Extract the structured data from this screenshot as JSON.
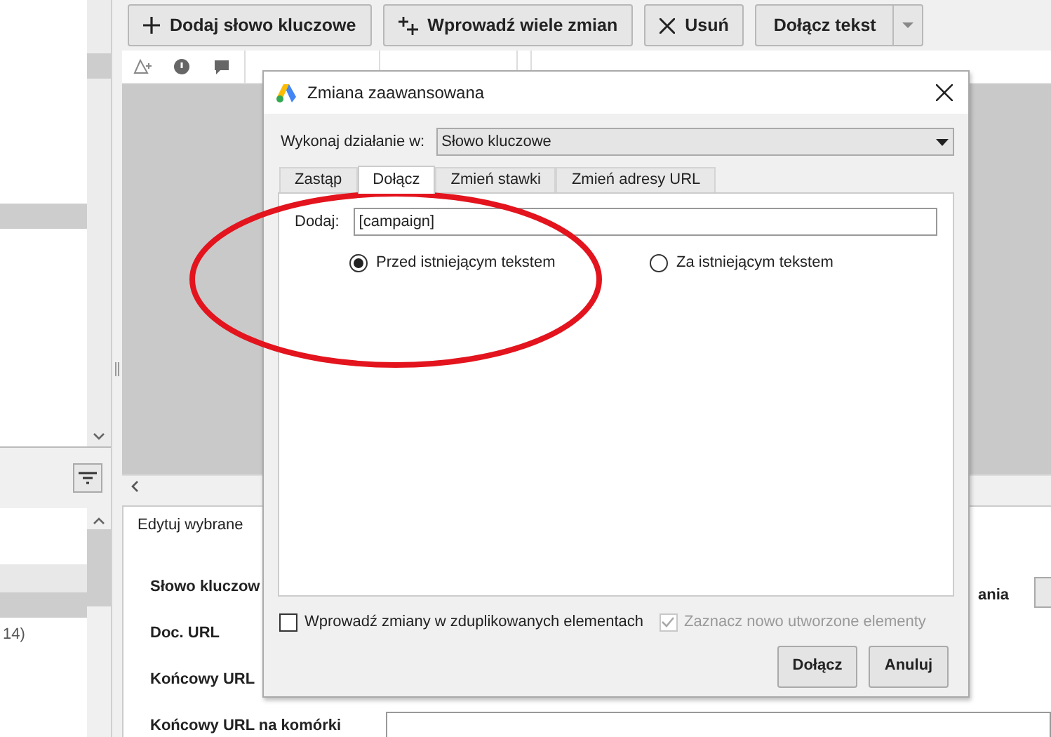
{
  "toolbar": {
    "buttons": [
      {
        "label": "Dodaj słowo kluczowe",
        "kind": "plus"
      },
      {
        "label": "Wprowadź wiele zmian",
        "kind": "multi"
      },
      {
        "label": "Usuń",
        "kind": "remove"
      },
      {
        "label": "Dołącz tekst",
        "kind": "split"
      }
    ]
  },
  "sidebar": {
    "items": [
      {
        "selected": false
      },
      {
        "selected": true
      }
    ],
    "counts": [
      "14)"
    ]
  },
  "edit_panel": {
    "tab": "Edytuj wybrane",
    "fields": [
      "Słowo kluczow",
      "Doc. URL",
      "Końcowy URL",
      "Końcowy URL na komórki"
    ],
    "side_label": "ania"
  },
  "dialog": {
    "title": "Zmiana zaawansowana",
    "action_label": "Wykonaj działanie w:",
    "action_value": "Słowo kluczowe",
    "tabs": [
      {
        "label": "Zastąp",
        "selected": false
      },
      {
        "label": "Dołącz",
        "selected": true
      },
      {
        "label": "Zmień stawki",
        "selected": false
      },
      {
        "label": "Zmień adresy URL",
        "selected": false
      }
    ],
    "add_label": "Dodaj:",
    "add_value": "[campaign]",
    "positions": [
      {
        "label": "Przed istniejącym tekstem",
        "selected": true
      },
      {
        "label": "Za istniejącym tekstem",
        "selected": false
      }
    ],
    "options": [
      {
        "label": "Wprowadź zmiany w zduplikowanych elementach",
        "checked": false,
        "disabled": false
      },
      {
        "label": "Zaznacz nowo utworzone elementy",
        "checked": true,
        "disabled": true
      }
    ],
    "buttons": [
      "Dołącz",
      "Anuluj"
    ]
  }
}
